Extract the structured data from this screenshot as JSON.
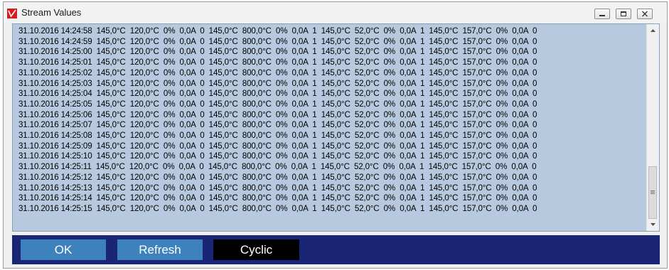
{
  "window": {
    "title": "Stream Values"
  },
  "stream": {
    "rows": [
      "31.10.2016 14:24:58  145,0°C  120,0°C  0%  0,0A  0  145,0°C  800,0°C  0%  0,0A  1  145,0°C  52,0°C  0%  0,0A  1  145,0°C  157,0°C  0%  0,0A  0",
      "31.10.2016 14:24:59  145,0°C  120,0°C  0%  0,0A  0  145,0°C  800,0°C  0%  0,0A  1  145,0°C  52,0°C  0%  0,0A  1  145,0°C  157,0°C  0%  0,0A  0",
      "31.10.2016 14:25:00  145,0°C  120,0°C  0%  0,0A  0  145,0°C  800,0°C  0%  0,0A  1  145,0°C  52,0°C  0%  0,0A  1  145,0°C  157,0°C  0%  0,0A  0",
      "31.10.2016 14:25:01  145,0°C  120,0°C  0%  0,0A  0  145,0°C  800,0°C  0%  0,0A  1  145,0°C  52,0°C  0%  0,0A  1  145,0°C  157,0°C  0%  0,0A  0",
      "31.10.2016 14:25:02  145,0°C  120,0°C  0%  0,0A  0  145,0°C  800,0°C  0%  0,0A  1  145,0°C  52,0°C  0%  0,0A  1  145,0°C  157,0°C  0%  0,0A  0",
      "31.10.2016 14:25:03  145,0°C  120,0°C  0%  0,0A  0  145,0°C  800,0°C  0%  0,0A  1  145,0°C  52,0°C  0%  0,0A  1  145,0°C  157,0°C  0%  0,0A  0",
      "31.10.2016 14:25:04  145,0°C  120,0°C  0%  0,0A  0  145,0°C  800,0°C  0%  0,0A  1  145,0°C  52,0°C  0%  0,0A  1  145,0°C  157,0°C  0%  0,0A  0",
      "31.10.2016 14:25:05  145,0°C  120,0°C  0%  0,0A  0  145,0°C  800,0°C  0%  0,0A  1  145,0°C  52,0°C  0%  0,0A  1  145,0°C  157,0°C  0%  0,0A  0",
      "31.10.2016 14:25:06  145,0°C  120,0°C  0%  0,0A  0  145,0°C  800,0°C  0%  0,0A  1  145,0°C  52,0°C  0%  0,0A  1  145,0°C  157,0°C  0%  0,0A  0",
      "31.10.2016 14:25:07  145,0°C  120,0°C  0%  0,0A  0  145,0°C  800,0°C  0%  0,0A  1  145,0°C  52,0°C  0%  0,0A  1  145,0°C  157,0°C  0%  0,0A  0",
      "31.10.2016 14:25:08  145,0°C  120,0°C  0%  0,0A  0  145,0°C  800,0°C  0%  0,0A  1  145,0°C  52,0°C  0%  0,0A  1  145,0°C  157,0°C  0%  0,0A  0",
      "31.10.2016 14:25:09  145,0°C  120,0°C  0%  0,0A  0  145,0°C  800,0°C  0%  0,0A  1  145,0°C  52,0°C  0%  0,0A  1  145,0°C  157,0°C  0%  0,0A  0",
      "31.10.2016 14:25:10  145,0°C  120,0°C  0%  0,0A  0  145,0°C  800,0°C  0%  0,0A  1  145,0°C  52,0°C  0%  0,0A  1  145,0°C  157,0°C  0%  0,0A  0",
      "31.10.2016 14:25:11  145,0°C  120,0°C  0%  0,0A  0  145,0°C  800,0°C  0%  0,0A  1  145,0°C  52,0°C  0%  0,0A  1  145,0°C  157,0°C  0%  0,0A  0",
      "31.10.2016 14:25:12  145,0°C  120,0°C  0%  0,0A  0  145,0°C  800,0°C  0%  0,0A  1  145,0°C  52,0°C  0%  0,0A  1  145,0°C  157,0°C  0%  0,0A  0",
      "31.10.2016 14:25:13  145,0°C  120,0°C  0%  0,0A  0  145,0°C  800,0°C  0%  0,0A  1  145,0°C  52,0°C  0%  0,0A  1  145,0°C  157,0°C  0%  0,0A  0",
      "31.10.2016 14:25:14  145,0°C  120,0°C  0%  0,0A  0  145,0°C  800,0°C  0%  0,0A  1  145,0°C  52,0°C  0%  0,0A  1  145,0°C  157,0°C  0%  0,0A  0",
      "31.10.2016 14:25:15  145,0°C  120,0°C  0%  0,0A  0  145,0°C  800,0°C  0%  0,0A  1  145,0°C  52,0°C  0%  0,0A  1  145,0°C  157,0°C  0%  0,0A  0"
    ]
  },
  "buttons": {
    "ok": "OK",
    "refresh": "Refresh",
    "cyclic": "Cyclic"
  },
  "icons": {
    "app_logo": "app-logo-icon",
    "minimize": "minimize-icon",
    "maximize": "maximize-icon",
    "close": "close-icon",
    "scroll_up": "scroll-up-icon",
    "scroll_down": "scroll-down-icon"
  },
  "colors": {
    "list_background": "#b6c9de",
    "bottom_bar": "#1a2675",
    "button_blue": "#3d82bd",
    "button_active": "#000000",
    "logo_red": "#d71920"
  }
}
